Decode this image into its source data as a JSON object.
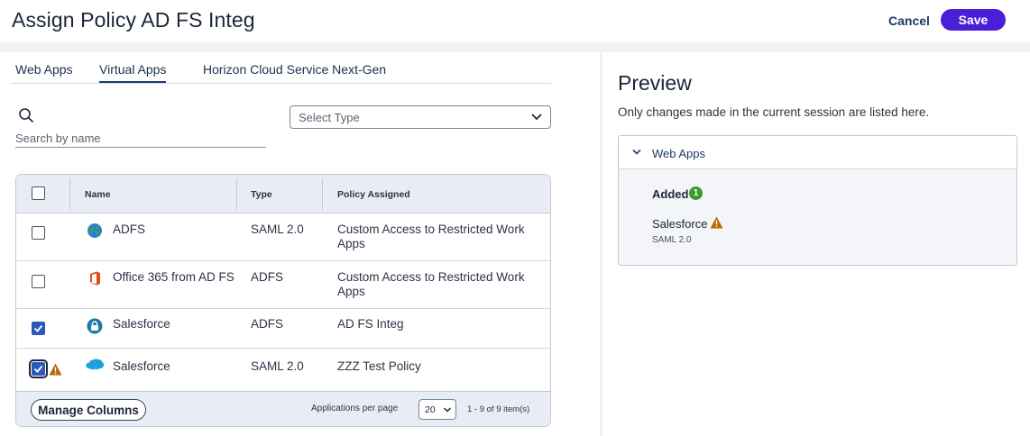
{
  "header": {
    "title": "Assign Policy AD FS Integ",
    "cancel_label": "Cancel",
    "save_label": "Save"
  },
  "tabs": [
    {
      "label": "Web Apps",
      "active": false
    },
    {
      "label": "Virtual Apps",
      "active": true
    },
    {
      "label": "Horizon Cloud Service Next-Gen",
      "active": false
    }
  ],
  "search": {
    "placeholder": "Search by name",
    "value": ""
  },
  "type_select": {
    "placeholder": "Select Type"
  },
  "table": {
    "columns": [
      "Name",
      "Type",
      "Policy Assigned"
    ],
    "rows": [
      {
        "name": "ADFS",
        "type": "SAML 2.0",
        "policy": "Custom Access to Restricted Work Apps",
        "checked": false,
        "icon": "globe-icon"
      },
      {
        "name": "Office 365 from AD FS",
        "type": "ADFS",
        "policy": "Custom Access to Restricted Work Apps",
        "checked": false,
        "icon": "office-365-icon"
      },
      {
        "name": "Salesforce",
        "type": "ADFS",
        "policy": "AD FS Integ",
        "checked": true,
        "icon": "lock-badge-icon"
      },
      {
        "name": "Salesforce",
        "type": "SAML 2.0",
        "policy": "ZZZ Test Policy",
        "checked": true,
        "icon": "salesforce-cloud-icon",
        "warning": true
      }
    ],
    "manage_columns_label": "Manage Columns",
    "per_page_label": "Applications per page",
    "per_page_value": "20",
    "pager_text": "1 - 9 of 9 item(s)"
  },
  "preview": {
    "title": "Preview",
    "subtitle": "Only changes made in the current session are listed here.",
    "section_label": "Web Apps",
    "added_label": "Added",
    "added_count": "1",
    "item_name": "Salesforce",
    "item_type": "SAML 2.0"
  },
  "colors": {
    "primary": "#4a1fd8",
    "checkbox_checked": "#2a5ab8",
    "warning": "#b36a00",
    "success": "#3d9b2c"
  }
}
